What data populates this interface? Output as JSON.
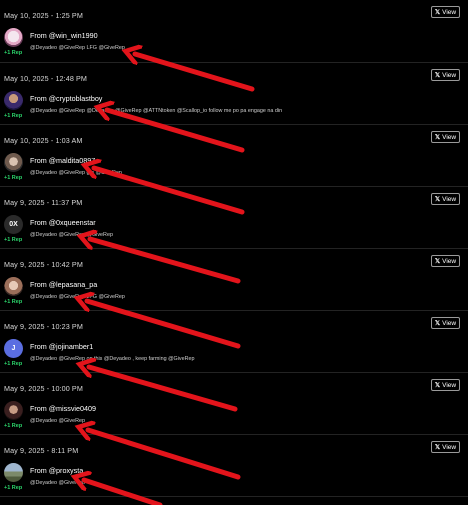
{
  "view_label": "View",
  "rep_label": "+1 Rep",
  "items": [
    {
      "date": "May 10, 2025 - 1:25 PM",
      "from": "From @win_win1990",
      "message": "@Deyadeo @GiveRep LFG @GiveRep",
      "avatar": "bunny"
    },
    {
      "date": "May 10, 2025 - 12:48 PM",
      "from": "From @cryptoblastboy",
      "message": "@Deyadeo @GiveRep @Deyadeo @GiveRep @ATTNtoken @Scallop_io follow me po pa engage na din",
      "avatar": "anime"
    },
    {
      "date": "May 10, 2025 - 1:03 AM",
      "from": "From @maldita0897",
      "message": "@Deyadeo @GiveRep gm @GiveRep",
      "avatar": "girl"
    },
    {
      "date": "May 9, 2025 - 11:37 PM",
      "from": "From @0xqueenstar",
      "message": "@Deyadeo @GiveRep @GiveRep",
      "avatar": "initials",
      "avatar_text": "0X"
    },
    {
      "date": "May 9, 2025 - 10:42 PM",
      "from": "From @lepasana_pa",
      "message": "@Deyadeo @GiveRep LFG @GiveRep",
      "avatar": "girl2"
    },
    {
      "date": "May 9, 2025 - 10:23 PM",
      "from": "From @jojinamber1",
      "message": "@Deyadeo @GiveRep on this @Deyadeo , keep farming @GiveRep",
      "avatar": "letter",
      "avatar_text": "J"
    },
    {
      "date": "May 9, 2025 - 10:00 PM",
      "from": "From @missvie0409",
      "message": "@Deyadeo @GiveRep",
      "avatar": "woman"
    },
    {
      "date": "May 9, 2025 - 8:11 PM",
      "from": "From @proxysta",
      "message": "@Deyadeo @GiveRep",
      "avatar": "landscape"
    }
  ],
  "colors": {
    "background": "#000000",
    "rep": "#2bd36a",
    "arrow": "#e3141b",
    "letter_avatar": "#5b6ee1"
  }
}
